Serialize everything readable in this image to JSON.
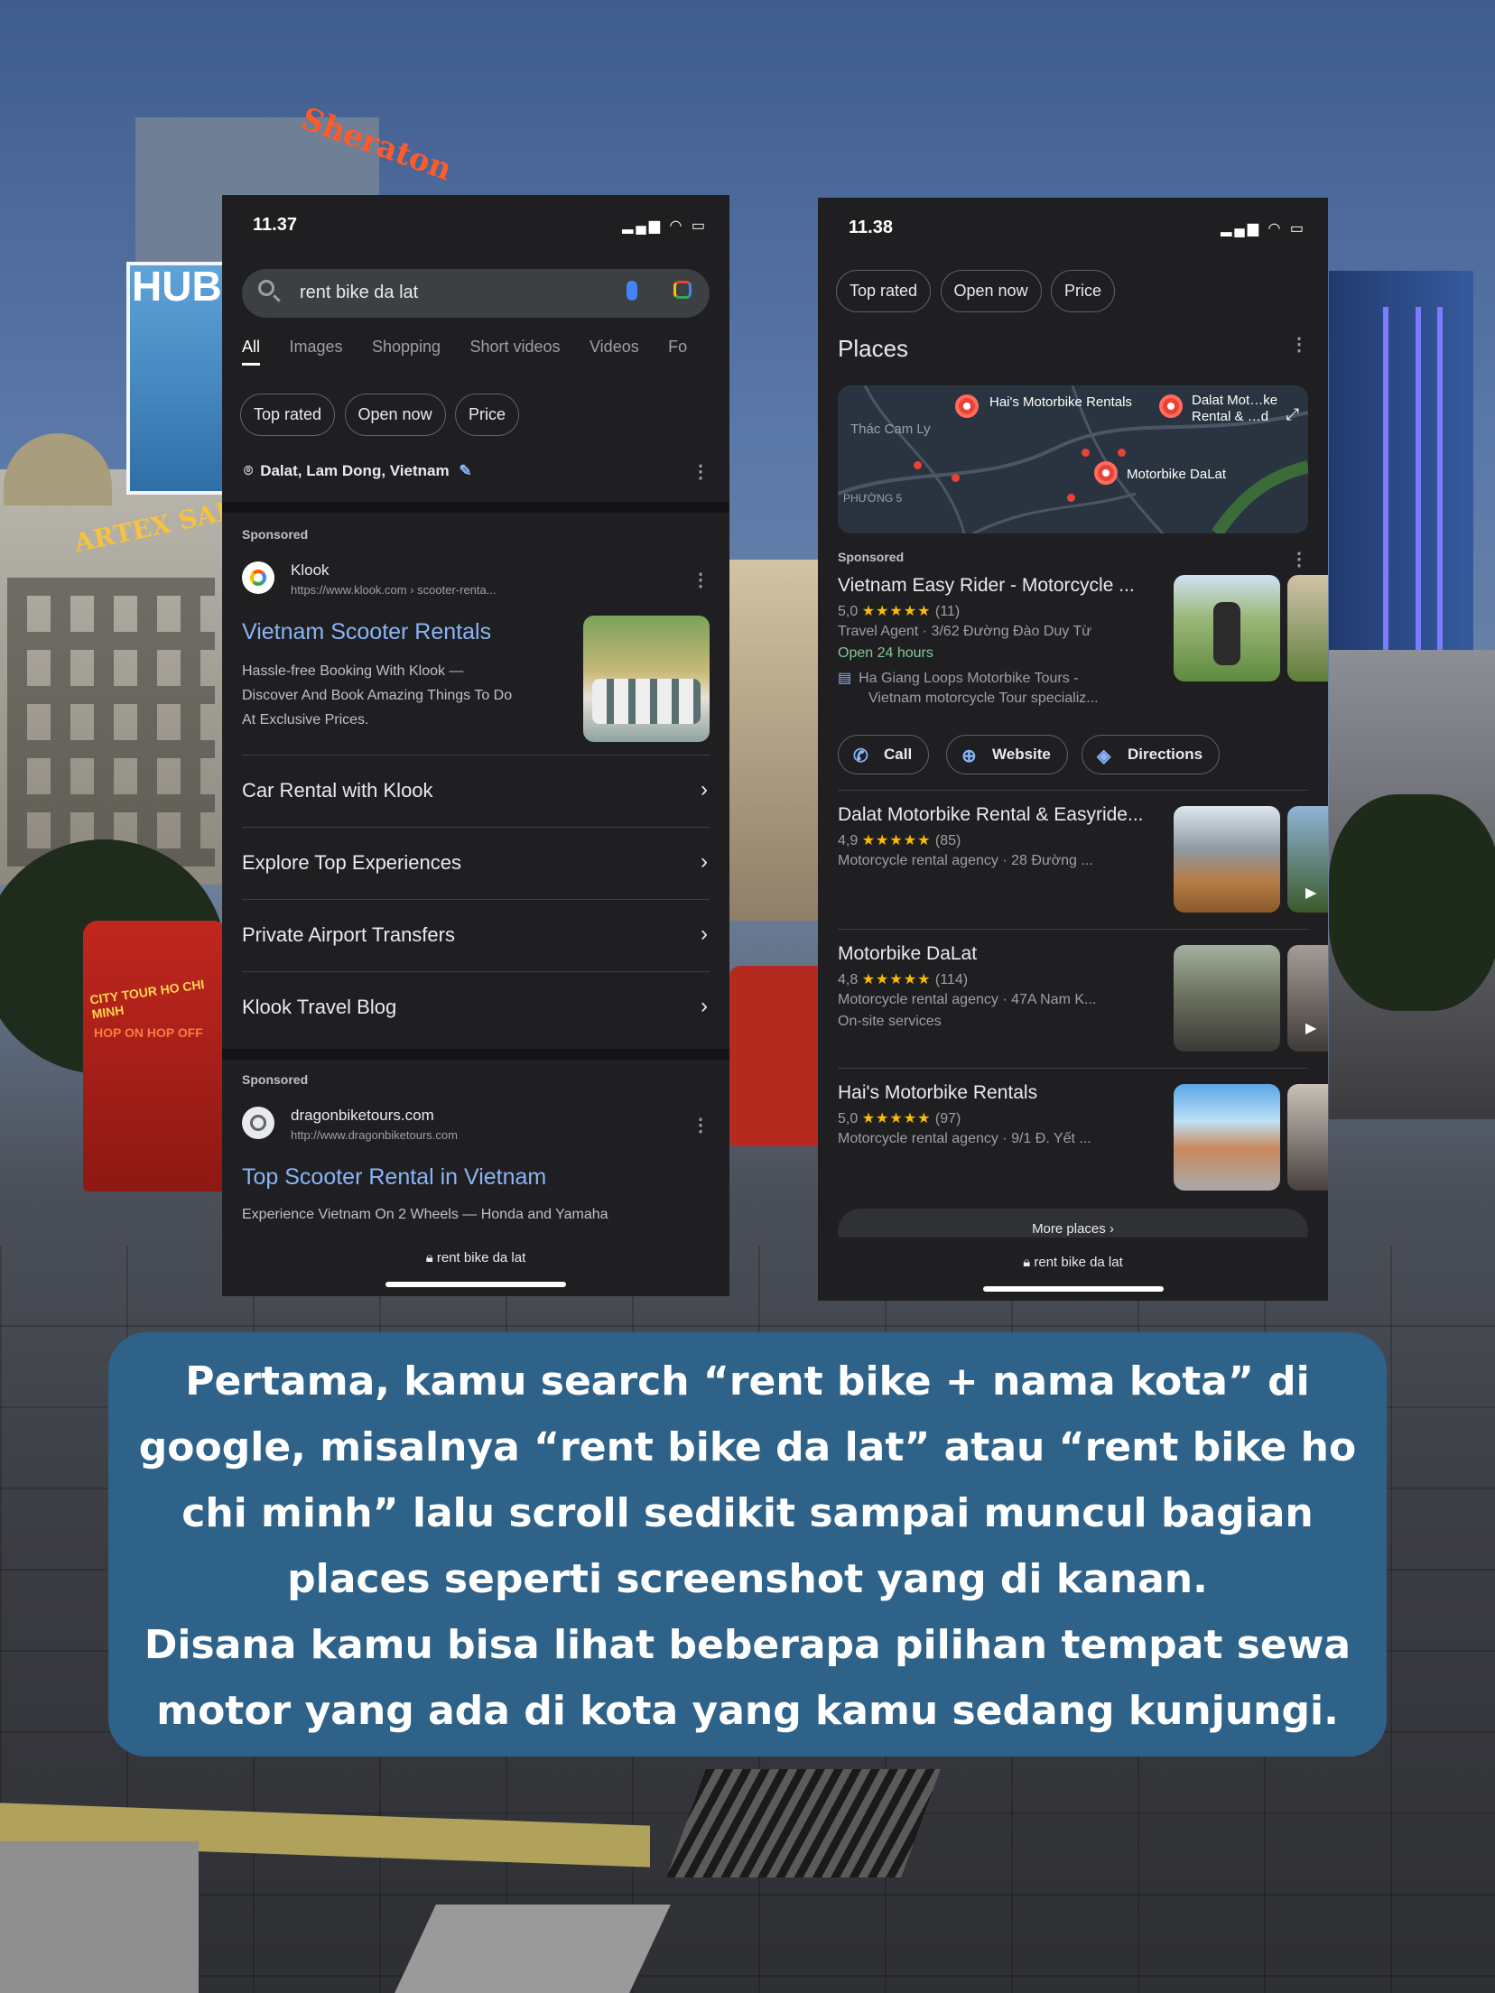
{
  "phone1": {
    "time": "11.37",
    "search_query": "rent bike da lat",
    "tabs": [
      "All",
      "Images",
      "Shopping",
      "Short videos",
      "Videos",
      "Fo"
    ],
    "chips": [
      "Top rated",
      "Open now",
      "Price"
    ],
    "location": "Dalat, Lam Dong, Vietnam",
    "ad1": {
      "sponsored": "Sponsored",
      "site_name": "Klook",
      "site_url": "https://www.klook.com › scooter-renta...",
      "title": "Vietnam Scooter Rentals",
      "desc_lines": [
        "Hassle-free Booking With Klook —",
        "Discover And Book Amazing Things To Do",
        "At Exclusive Prices."
      ]
    },
    "sitelinks": [
      "Car Rental with Klook",
      "Explore Top Experiences",
      "Private Airport Transfers",
      "Klook Travel Blog"
    ],
    "ad2": {
      "sponsored": "Sponsored",
      "site_name": "dragonbiketours.com",
      "site_url": "http://www.dragonbiketours.com",
      "title": "Top Scooter Rental in Vietnam",
      "desc": "Experience Vietnam On 2 Wheels — Honda and Yamaha"
    },
    "url_bar": "rent bike da lat"
  },
  "phone2": {
    "time": "11.38",
    "chips": [
      "Top rated",
      "Open now",
      "Price"
    ],
    "section_title": "Places",
    "map_labels": {
      "hais": "Hai's Motorbike Rentals",
      "dalat": "Dalat Mot…ke Rental & …d",
      "motorbike": "Motorbike DaLat",
      "thac": "Thác Cam Ly",
      "phuong": "PHƯỜNG 5"
    },
    "sponsored": "Sponsored",
    "places": [
      {
        "name": "Vietnam Easy Rider - Motorcycle ...",
        "rating": "5,0",
        "stars": "★★★★★",
        "reviews": "(11)",
        "line1": "Travel Agent · 3/62 Đường Đào Duy Từ",
        "hours": "Open 24 hours",
        "line3": "Ha Giang Loops Motorbike Tours -",
        "line4": "Vietnam motorcycle Tour specializ..."
      },
      {
        "name": "Dalat Motorbike Rental & Easyride...",
        "rating": "4,9",
        "stars": "★★★★★",
        "reviews": "(85)",
        "line1": "Motorcycle rental agency · 28 Đường ..."
      },
      {
        "name": "Motorbike DaLat",
        "rating": "4,8",
        "stars": "★★★★★",
        "reviews": "(114)",
        "line1": "Motorcycle rental agency · 47A Nam K...",
        "line2": "On-site services"
      },
      {
        "name": "Hai's Motorbike Rentals",
        "rating": "5,0",
        "stars": "★★★★★",
        "reviews": "(97)",
        "line1": "Motorcycle rental agency · 9/1 Đ. Yết ..."
      }
    ],
    "actions": [
      "Call",
      "Website",
      "Directions"
    ],
    "more_places": "More places",
    "url_bar": "rent bike da lat"
  },
  "caption": {
    "lines": [
      "Pertama, kamu search “rent bike + nama kota” di",
      "google, misalnya “rent bike da lat” atau “rent bike ho",
      "chi minh” lalu scroll sedikit sampai muncul bagian",
      "places seperti screenshot yang di kanan.",
      "Disana kamu bisa lihat beberapa pilihan tempat sewa",
      "motor yang ada di kota yang kamu sedang kunjungi."
    ]
  },
  "background": {
    "signs": [
      "Sheraton",
      "HUBL",
      "ARTEX SAIGON",
      "CITY TOUR HO CHI MINH",
      "HOP ON HOP OFF"
    ]
  },
  "colors": {
    "caption_bg": "#2e6288",
    "phone_bg": "#1f1f21",
    "link_blue": "#8ab4f8",
    "star_yellow": "#fbbc04",
    "open_green": "#81c995"
  }
}
